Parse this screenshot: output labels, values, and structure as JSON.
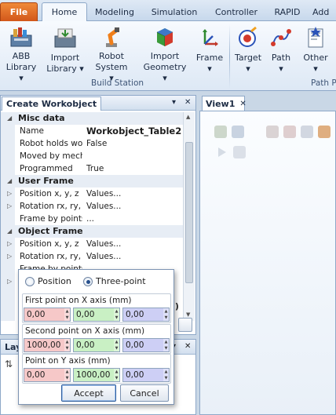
{
  "ribbon_tabs": [
    "File",
    "Home",
    "Modeling",
    "Simulation",
    "Controller",
    "RAPID",
    "Add"
  ],
  "ribbon": {
    "abb_library": {
      "line1": "ABB",
      "line2": "Library ▾"
    },
    "import_library": {
      "line1": "Import",
      "line2": "Library ▾"
    },
    "robot_system": {
      "line1": "Robot",
      "line2": "System ▾"
    },
    "import_geometry": {
      "line1": "Import",
      "line2": "Geometry ▾"
    },
    "frame": {
      "line1": "Frame",
      "line2": "▾"
    },
    "target": {
      "line1": "Target",
      "line2": "▾"
    },
    "path": {
      "line1": "Path",
      "line2": "▾"
    },
    "other": {
      "line1": "Other",
      "line2": "▾"
    },
    "group_build_station": "Build Station",
    "group_path_programming": "Path Pr"
  },
  "panel": {
    "title": "Create Workobject",
    "pin_icon": "▾",
    "close_icon": "✕",
    "sections": {
      "misc": "Misc data",
      "user_frame": "User Frame",
      "object_frame": "Object Frame"
    },
    "props": {
      "name": {
        "key": "Name",
        "value": "Workobject_Table2"
      },
      "robot_holds": {
        "key": "Robot holds workobject",
        "value": "False"
      },
      "moved_by": {
        "key": "Moved by mechanical unit",
        "value": ""
      },
      "programmed": {
        "key": "Programmed",
        "value": "True"
      },
      "uf_position": {
        "key": "Position x, y, z",
        "value": "Values..."
      },
      "uf_rotation": {
        "key": "Rotation rx, ry, rz",
        "value": "Values..."
      },
      "uf_frame_by_points": {
        "key": "Frame by points",
        "value": "..."
      },
      "of_position": {
        "key": "Position x, y, z",
        "value": "Values..."
      },
      "of_rotation": {
        "key": "Rotation rx, ry, rz",
        "value": "Values..."
      },
      "of_frame_by_points": {
        "key": "Frame by points",
        "value": ""
      }
    },
    "hidden_value_fragment": ")"
  },
  "layout_panel": {
    "title": "Lay"
  },
  "view": {
    "tab_label": "View1",
    "close_icon": "✕"
  },
  "dialog": {
    "radio_position": "Position",
    "radio_three_point": "Three-point",
    "selected": "Three-point",
    "groups": [
      {
        "label": "First point on X axis (mm)",
        "x": "0,00",
        "y": "0,00",
        "z": "0,00"
      },
      {
        "label": "Second point on X axis (mm)",
        "x": "1000,00",
        "y": "0,00",
        "z": "0,00"
      },
      {
        "label": "Point on Y axis (mm)",
        "x": "0,00",
        "y": "1000,00",
        "z": "0,00"
      }
    ],
    "accept": "Accept",
    "cancel": "Cancel"
  },
  "colors": {
    "file_tab": "#e06a22",
    "x_field": "#f6c8c8",
    "y_field": "#c9f0c4",
    "z_field": "#cdcff5"
  }
}
